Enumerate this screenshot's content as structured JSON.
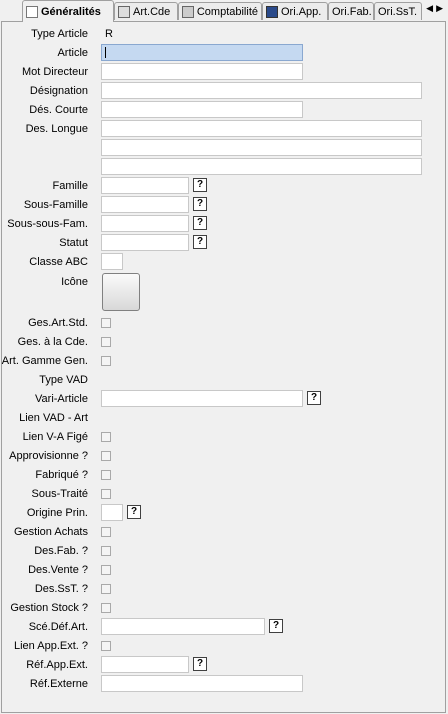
{
  "tabs": [
    {
      "label": "Généralités",
      "icon": "document-icon"
    },
    {
      "label": "Art.Cde",
      "icon": "printer-icon"
    },
    {
      "label": "Comptabilité",
      "icon": "calculator-icon"
    },
    {
      "label": "Ori.App.",
      "icon": "book-icon"
    },
    {
      "label": "Ori.Fab.",
      "icon": ""
    },
    {
      "label": "Ori.SsT.",
      "icon": ""
    }
  ],
  "form": {
    "type_article": {
      "label": "Type Article",
      "value": "R"
    },
    "article": {
      "label": "Article"
    },
    "mot_directeur": {
      "label": "Mot Directeur"
    },
    "designation": {
      "label": "Désignation"
    },
    "des_courte": {
      "label": "Dés. Courte"
    },
    "des_longue": {
      "label": "Des. Longue"
    },
    "famille": {
      "label": "Famille"
    },
    "sous_famille": {
      "label": "Sous-Famille"
    },
    "sous_sous_fam": {
      "label": "Sous-sous-Fam."
    },
    "statut": {
      "label": "Statut"
    },
    "classe_abc": {
      "label": "Classe ABC"
    },
    "icone": {
      "label": "Icône"
    },
    "ges_art_std": {
      "label": "Ges.Art.Std."
    },
    "ges_a_la_cde": {
      "label": "Ges. à la Cde."
    },
    "art_gamme_gen": {
      "label": "Art. Gamme Gen."
    },
    "type_vad": {
      "label": "Type VAD"
    },
    "vari_article": {
      "label": "Vari-Article"
    },
    "lien_vad_art": {
      "label": "Lien VAD - Art"
    },
    "lien_va_fige": {
      "label": "Lien V-A Figé"
    },
    "approvisionne": {
      "label": "Approvisionne ?"
    },
    "fabrique": {
      "label": "Fabriqué ?"
    },
    "sous_traite": {
      "label": "Sous-Traité"
    },
    "origine_prin": {
      "label": "Origine Prin."
    },
    "gestion_achats": {
      "label": "Gestion Achats"
    },
    "des_fab": {
      "label": "Des.Fab. ?"
    },
    "des_vente": {
      "label": "Des.Vente ?"
    },
    "des_sst": {
      "label": "Des.SsT. ?"
    },
    "gestion_stock": {
      "label": "Gestion Stock ?"
    },
    "sce_def_art": {
      "label": "Scé.Déf.Art."
    },
    "lien_app_ext": {
      "label": "Lien App.Ext. ?"
    },
    "ref_app_ext": {
      "label": "Réf.App.Ext."
    },
    "ref_externe": {
      "label": "Réf.Externe"
    }
  },
  "lookup_button_label": "?",
  "scroll_arrows": "◀▶"
}
